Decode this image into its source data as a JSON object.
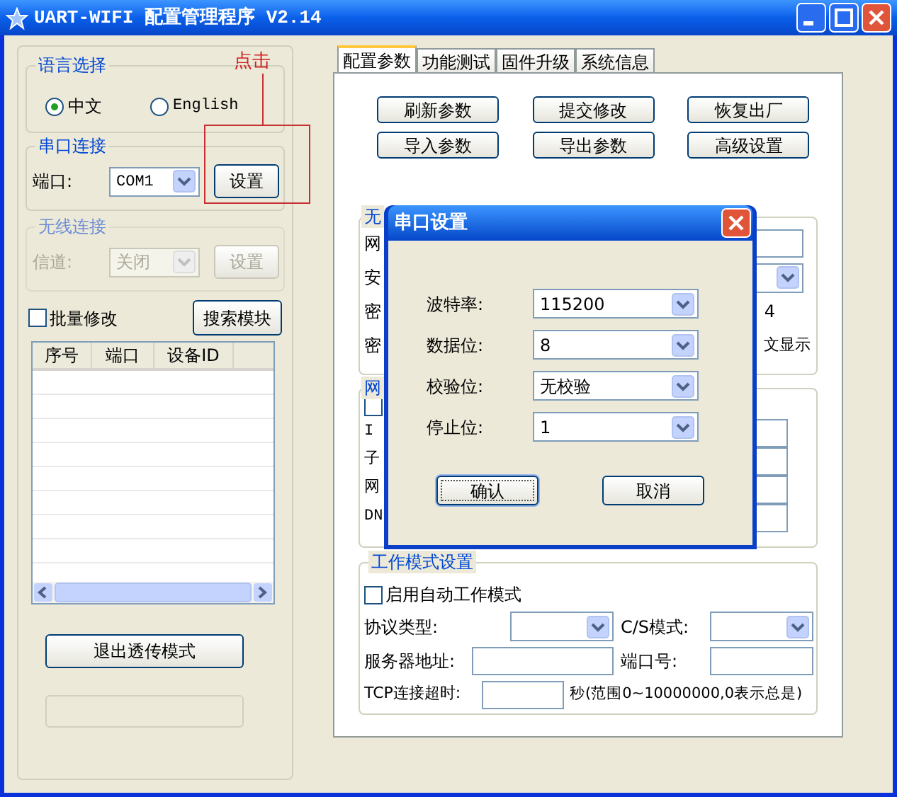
{
  "window": {
    "title": "UART-WIFI 配置管理程序 V2.14"
  },
  "language": {
    "title": "语言选择",
    "options": [
      {
        "label": "中文",
        "selected": true
      },
      {
        "label": "English",
        "selected": false
      }
    ]
  },
  "serial": {
    "title": "串口连接",
    "port_label": "端口:",
    "port_value": "COM1",
    "button": "设置"
  },
  "wireless": {
    "title": "无线连接",
    "disabled": true,
    "channel_label": "信道:",
    "channel_value": "关闭",
    "button": "设置"
  },
  "batch": {
    "label": "批量修改",
    "checked": false
  },
  "search_button": "搜索模块",
  "device_table": {
    "columns": [
      "序号",
      "端口",
      "设备ID"
    ]
  },
  "exit_button": "退出透传模式",
  "annotation": {
    "text": "点击"
  },
  "tabs": [
    {
      "label": "配置参数",
      "selected": true
    },
    {
      "label": "功能测试",
      "selected": false
    },
    {
      "label": "固件升级",
      "selected": false
    },
    {
      "label": "系统信息",
      "selected": false
    }
  ],
  "actions": [
    "刷新参数",
    "提交修改",
    "恢复出厂",
    "导入参数",
    "导出参数",
    "高级设置"
  ],
  "wireless_group": {
    "title": "无",
    "rows": [
      {
        "kind": "field",
        "label": "网"
      },
      {
        "kind": "select",
        "label": "安"
      },
      {
        "kind": "text",
        "label": "密",
        "text": "4"
      },
      {
        "kind": "text",
        "label": "密",
        "text": "文显示"
      }
    ]
  },
  "network_group": {
    "title": "网",
    "checkbox": {
      "checked": false
    },
    "rows": [
      {
        "label": "I"
      },
      {
        "label": "子"
      },
      {
        "label": "网"
      },
      {
        "label": "DN"
      }
    ]
  },
  "work_mode": {
    "title": "工作模式设置",
    "auto": {
      "label": "启用自动工作模式",
      "checked": false
    },
    "protocol_label": "协议类型:",
    "cs_label": "C/S模式:",
    "server_label": "服务器地址:",
    "port_label": "端口号:",
    "timeout_label": "TCP连接超时:",
    "timeout_hint": "秒(范围0~10000000,0表示总是)"
  },
  "dialog": {
    "title": "串口设置",
    "fields": [
      {
        "label": "波特率:",
        "value": "115200"
      },
      {
        "label": "数据位:",
        "value": "8"
      },
      {
        "label": "校验位:",
        "value": "无校验"
      },
      {
        "label": "停止位:",
        "value": "1"
      }
    ],
    "buttons": [
      {
        "label": "确认",
        "focused": true
      },
      {
        "label": "取消",
        "focused": false
      }
    ]
  }
}
